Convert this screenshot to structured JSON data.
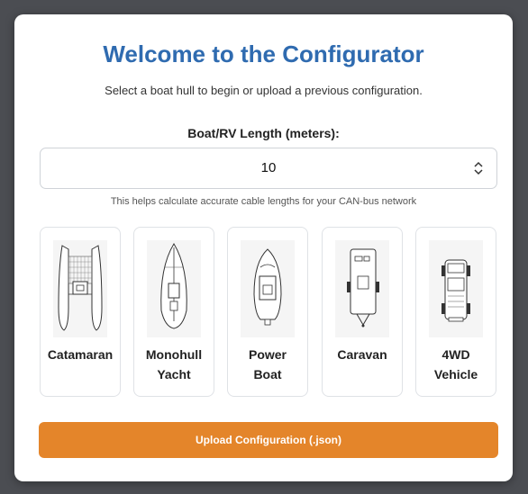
{
  "header": {
    "title": "Welcome to the Configurator",
    "subtitle": "Select a boat hull to begin or upload a previous configuration."
  },
  "length": {
    "label": "Boat/RV Length (meters):",
    "value": "10",
    "hint": "This helps calculate accurate cable lengths for your CAN-bus network"
  },
  "hulls": [
    {
      "label_line1": "Catamaran",
      "label_line2": "",
      "icon": "catamaran-icon"
    },
    {
      "label_line1": "Monohull",
      "label_line2": "Yacht",
      "icon": "monohull-yacht-icon"
    },
    {
      "label_line1": "Power",
      "label_line2": "Boat",
      "icon": "power-boat-icon"
    },
    {
      "label_line1": "Caravan",
      "label_line2": "",
      "icon": "caravan-icon"
    },
    {
      "label_line1": "4WD",
      "label_line2": "Vehicle",
      "icon": "4wd-vehicle-icon"
    }
  ],
  "upload": {
    "label": "Upload Configuration (.json)"
  },
  "colors": {
    "title": "#2f6bb0",
    "upload_button": "#e4852a",
    "background": "#4b4d52"
  }
}
